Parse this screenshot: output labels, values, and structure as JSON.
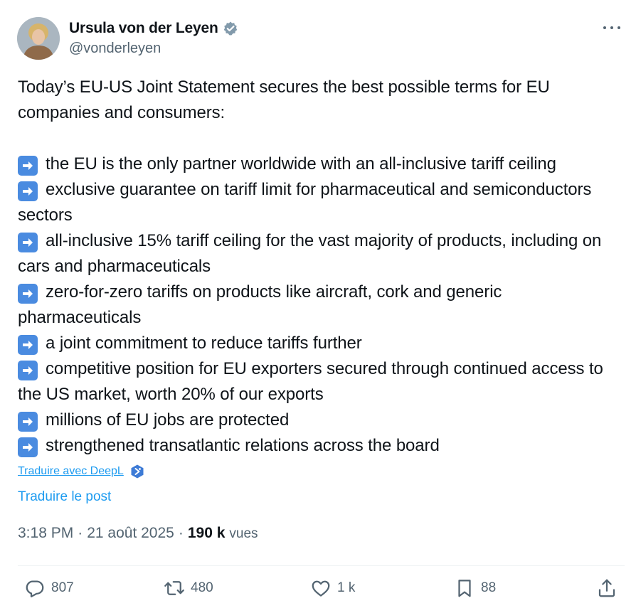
{
  "author": {
    "name": "Ursula von der Leyen",
    "handle": "@vonderleyen",
    "verified_icon": "verified-badge-icon",
    "avatar_icon": "avatar"
  },
  "tweet": {
    "intro": "Today’s EU-US Joint Statement secures the best possible terms for EU companies and consumers:",
    "bullets": [
      "the EU is the only partner worldwide with an all-inclusive tariff ceiling",
      "exclusive guarantee on tariff limit for pharmaceutical and semiconductors sectors",
      "all-inclusive 15% tariff ceiling for the vast majority of products, including on cars and pharmaceuticals",
      "zero-for-zero tariffs on products like aircraft, cork and generic pharmaceuticals",
      "a joint commitment to reduce tariffs further",
      "competitive position for EU exporters secured through continued access to the US market, worth 20% of our exports",
      "millions of EU jobs are protected",
      "strengthened transatlantic relations across the board"
    ]
  },
  "translate": {
    "deepl_label": "Traduire avec DeepL",
    "post_label": "Traduire le post"
  },
  "meta": {
    "time": "3:18 PM",
    "date": "21 août 2025",
    "views_count": "190 k",
    "views_label": "vues",
    "separator": "·"
  },
  "actions": {
    "replies": "807",
    "reposts": "480",
    "likes": "1 k",
    "bookmarks": "88"
  },
  "colors": {
    "accent": "#1d9bf0",
    "text": "#0f1419",
    "muted": "#536471",
    "arrow_emoji": "#4a8be0"
  }
}
